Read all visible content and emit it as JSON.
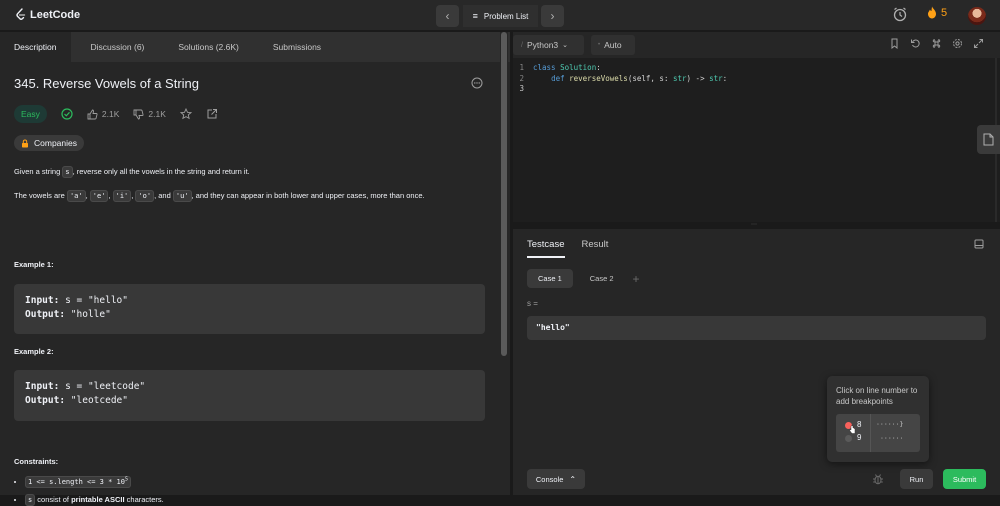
{
  "header": {
    "logo": "LeetCode",
    "problem_list": "Problem List",
    "streak": "5"
  },
  "left": {
    "tabs": [
      "Description",
      "Discussion (6)",
      "Solutions (2.6K)",
      "Submissions"
    ],
    "title": "345. Reverse Vowels of a String",
    "difficulty": "Easy",
    "likes": "2.1K",
    "dislikes": "2.1K",
    "companies": "Companies",
    "desc1_pre": "Given a string ",
    "desc1_code": "s",
    "desc1_post": ", reverse only all the vowels in the string and return it.",
    "desc2_pre": "The vowels are ",
    "vowels": [
      "'a'",
      "'e'",
      "'i'",
      "'o'",
      "'u'"
    ],
    "desc2_and": ", and ",
    "desc2_post": ", and they can appear in both lower and upper cases, more than once.",
    "example1_title": "Example 1:",
    "example1_input_label": "Input:",
    "example1_input": "s = \"hello\"",
    "example1_output_label": "Output:",
    "example1_output": "\"holle\"",
    "example2_title": "Example 2:",
    "example2_input_label": "Input:",
    "example2_input": "s = \"leetcode\"",
    "example2_output_label": "Output:",
    "example2_output": "\"leotcede\"",
    "constraints_title": "Constraints:",
    "constraint1": "1 <= s.length <= 3 * 10",
    "constraint1_exp": "5",
    "constraint2_code": "s",
    "constraint2_mid": " consist of ",
    "constraint2_bold": "printable ASCII",
    "constraint2_post": " characters."
  },
  "editor": {
    "language": "Python3",
    "auto": "Auto",
    "lines": [
      {
        "n": "1",
        "code": "class Solution:"
      },
      {
        "n": "2",
        "code": "    def reverseVowels(self, s: str) -> str:"
      },
      {
        "n": "3",
        "code": ""
      }
    ]
  },
  "testcase": {
    "tabs": [
      "Testcase",
      "Result"
    ],
    "cases": [
      "Case 1",
      "Case 2"
    ],
    "add": "+",
    "s_label": "s =",
    "s_value": "\"hello\"",
    "tooltip": "Click on line number to add breakpoints",
    "bp_line1": "8",
    "bp_line2": "9",
    "bp_code1": "······}",
    "bp_code2": "······",
    "console": "Console",
    "run": "Run",
    "submit": "Submit"
  }
}
